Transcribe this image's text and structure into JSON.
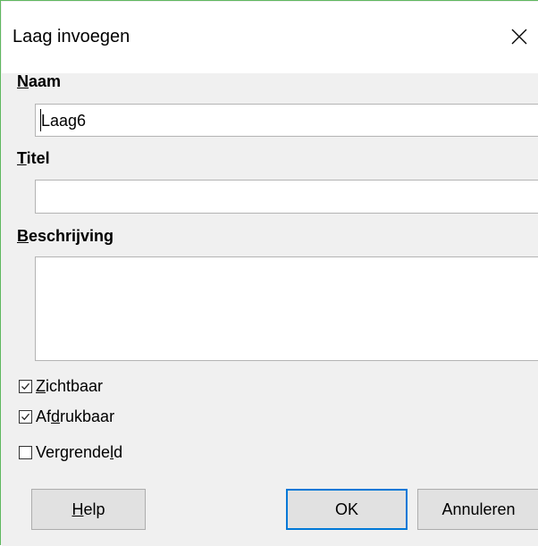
{
  "window": {
    "title": "Laag invoegen",
    "close_icon": "close-icon"
  },
  "fields": {
    "name": {
      "label_first": "N",
      "label_rest": "aam",
      "value": "Laag6"
    },
    "title": {
      "label_first": "T",
      "label_rest": "itel",
      "value": ""
    },
    "description": {
      "label_first": "B",
      "label_rest": "eschrijving",
      "value": ""
    }
  },
  "checkboxes": [
    {
      "label_pre": "",
      "label_u": "Z",
      "label_post": "ichtbaar",
      "checked": true
    },
    {
      "label_pre": "Af",
      "label_u": "d",
      "label_post": "rukbaar",
      "checked": true
    },
    {
      "label_pre": "Vergrende",
      "label_u": "l",
      "label_post": "d",
      "checked": false
    }
  ],
  "buttons": {
    "help_u": "H",
    "help_rest": "elp",
    "ok": "OK",
    "cancel": "Annuleren"
  },
  "colors": {
    "focus": "#0078d7",
    "window_border": "#5fb85f"
  }
}
